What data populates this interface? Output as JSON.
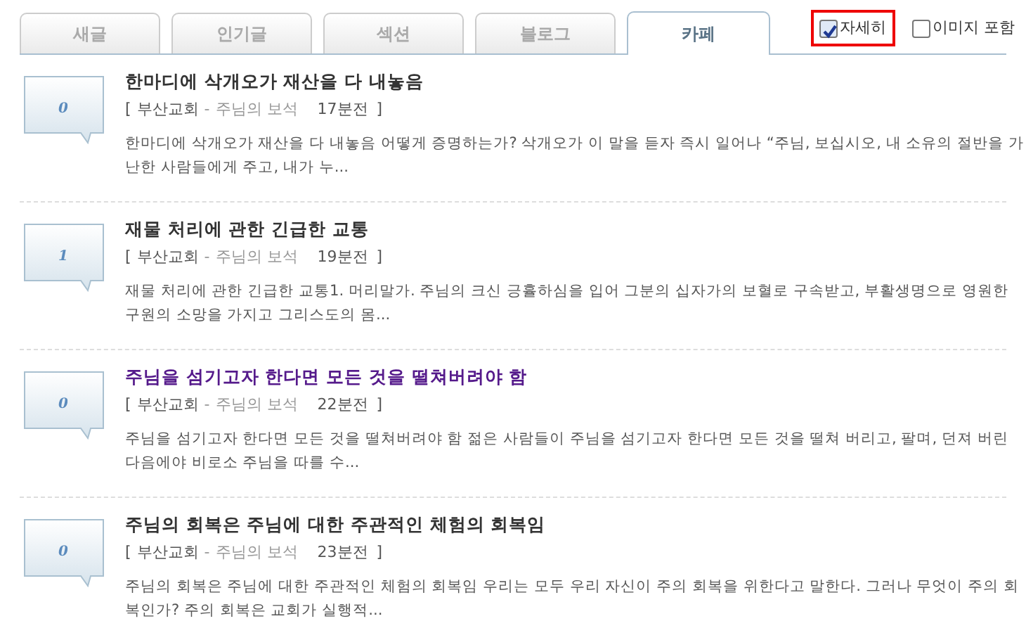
{
  "tabs": [
    {
      "label": "새글",
      "selected": false
    },
    {
      "label": "인기글",
      "selected": false
    },
    {
      "label": "섹션",
      "selected": false
    },
    {
      "label": "블로그",
      "selected": false
    },
    {
      "label": "카페",
      "selected": true
    }
  ],
  "options": [
    {
      "label": "자세히",
      "checked": true,
      "highlighted": true
    },
    {
      "label": "이미지 포함",
      "checked": false,
      "highlighted": false
    }
  ],
  "posts": [
    {
      "comments": "0",
      "title": "한마디에 삭개오가 재산을 다 내놓음",
      "visited": false,
      "open": "[",
      "cafe": "부산교회",
      "sep": "-",
      "board": "주님의 보석",
      "time": "17분전",
      "close": "]",
      "snippet": "한마디에 삭개오가 재산을 다 내놓음 어떻게 증명하는가? 삭개오가 이 말을 듣자 즉시 일어나 “주님, 보십시오, 내 소유의 절반을 가난한 사람들에게 주고, 내가 누..."
    },
    {
      "comments": "1",
      "title": "재물 처리에 관한 긴급한 교통",
      "visited": false,
      "open": "[",
      "cafe": "부산교회",
      "sep": "-",
      "board": "주님의 보석",
      "time": "19분전",
      "close": "]",
      "snippet": "재물 처리에 관한 긴급한 교통1. 머리말가. 주님의 크신 긍휼하심을 입어 그분의 십자가의 보혈로 구속받고, 부활생명으로 영원한 구원의 소망을 가지고 그리스도의 몸..."
    },
    {
      "comments": "0",
      "title": "주님을 섬기고자 한다면 모든 것을 떨쳐버려야 함",
      "visited": true,
      "open": "[",
      "cafe": "부산교회",
      "sep": "-",
      "board": "주님의 보석",
      "time": "22분전",
      "close": "]",
      "snippet": "주님을 섬기고자 한다면 모든 것을 떨쳐버려야 함 젊은 사람들이 주님을 섬기고자 한다면 모든 것을 떨쳐 버리고, 팔며, 던져 버린 다음에야 비로소 주님을 따를 수..."
    },
    {
      "comments": "0",
      "title": "주님의 회복은 주님에 대한 주관적인 체험의 회복임",
      "visited": false,
      "open": "[",
      "cafe": "부산교회",
      "sep": "-",
      "board": "주님의 보석",
      "time": "23분전",
      "close": "]",
      "snippet": "주님의 회복은 주님에 대한 주관적인 체험의 회복임 우리는 모두 우리 자신이 주의 회복을 위한다고 말한다. 그러나 무엇이 주의 회복인가? 주의 회복은 교회가 실행적..."
    }
  ]
}
